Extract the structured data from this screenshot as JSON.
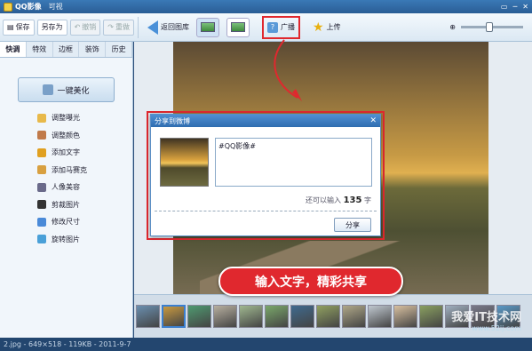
{
  "window": {
    "title": "QQ影像",
    "version": "可视",
    "controls": [
      "▭",
      "─",
      "✕"
    ]
  },
  "toolbar": {
    "save": "保存",
    "save_as": "另存为",
    "undo": "撤销",
    "redo": "重做",
    "back": "返回图库",
    "broadcast": "广播",
    "upload": "上传"
  },
  "sidebar": {
    "tabs": [
      "快调",
      "特效",
      "边框",
      "装饰",
      "历史"
    ],
    "active_tab": "快调",
    "beautify": "一键美化",
    "items": [
      {
        "label": "调整曝光",
        "icon": "exposure-icon",
        "color": "#e8b94a"
      },
      {
        "label": "调整颜色",
        "icon": "color-icon",
        "color": "#c07a4a"
      },
      {
        "label": "添加文字",
        "icon": "text-icon",
        "color": "#e0a020"
      },
      {
        "label": "添加马赛克",
        "icon": "mosaic-icon",
        "color": "#d8a040"
      },
      {
        "label": "人像美容",
        "icon": "portrait-icon",
        "color": "#6a6a8a"
      },
      {
        "label": "剪裁图片",
        "icon": "crop-icon",
        "color": "#333333"
      },
      {
        "label": "修改尺寸",
        "icon": "resize-icon",
        "color": "#4a8ad8"
      },
      {
        "label": "旋转图片",
        "icon": "rotate-icon",
        "color": "#4aa0d8"
      }
    ]
  },
  "dialog": {
    "title": "分享到微博",
    "text": "#QQ影像#",
    "remaining_prefix": "还可以输入",
    "remaining_count": "135",
    "remaining_suffix": "字",
    "share_button": "分享",
    "close": "✕"
  },
  "callout": "输入文字，精彩共享",
  "filmstrip": {
    "colors": [
      "#6a8fb0",
      "#c99a40",
      "#4f9a70",
      "#b8b0a0",
      "#a0b890",
      "#7aa86a",
      "#3f6a8f",
      "#90a060",
      "#b0a888",
      "#c0c8d0",
      "#d8c0a0",
      "#8aa060",
      "#a0b0c0",
      "#7a7a8a",
      "#5a9ac8"
    ],
    "selected_index": 1
  },
  "status": "2.jpg - 649×518 - 119KB - 2011-9-7",
  "watermark": {
    "main": "我爱IT技术网",
    "sub": "www.52ij.com"
  },
  "colors": {
    "accent": "#e0282e",
    "titlebar": "#2a5d95"
  }
}
